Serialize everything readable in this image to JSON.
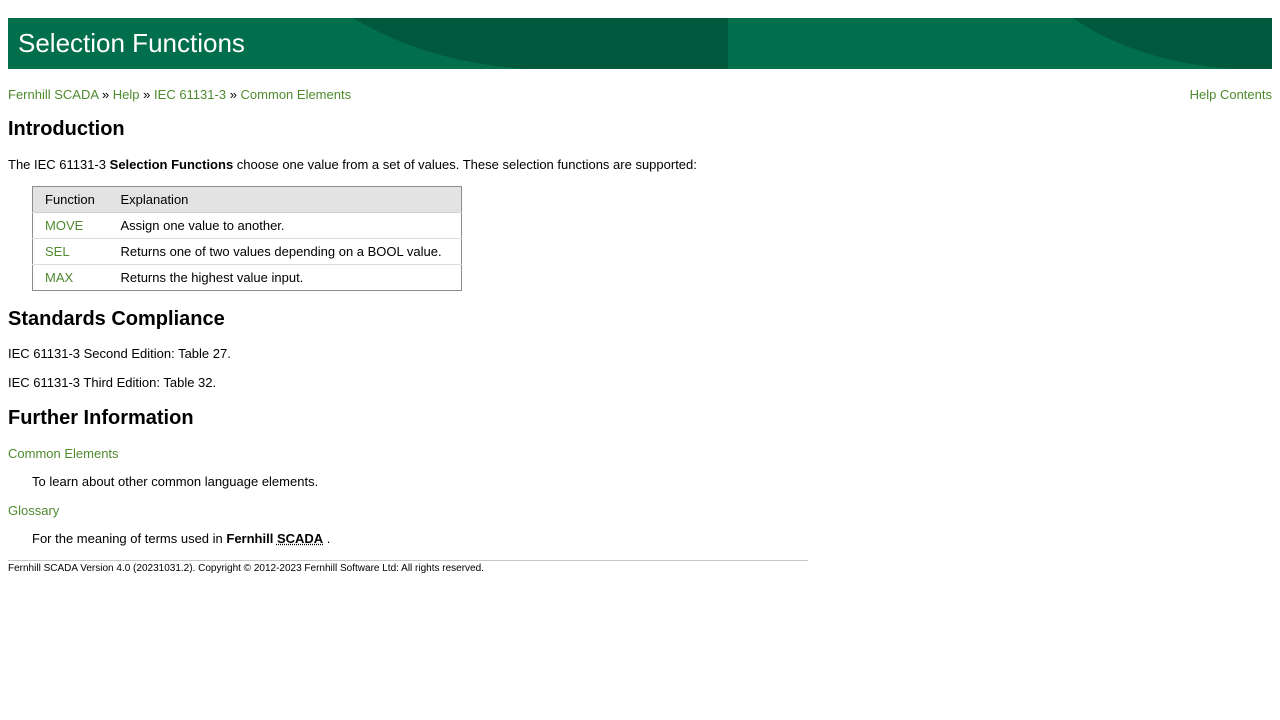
{
  "banner": {
    "title": "Selection Functions",
    "color": "#016e4c"
  },
  "breadcrumb": {
    "items": [
      "Fernhill SCADA",
      "Help",
      "IEC 61131-3",
      "Common Elements"
    ],
    "separator": "»"
  },
  "help_contents": "Help Contents",
  "introduction": {
    "heading": "Introduction",
    "text_before": "The IEC 61131-3 ",
    "text_bold": "Selection Functions",
    "text_after": " choose one value from a set of values. These selection functions are supported:"
  },
  "table": {
    "headers": [
      "Function",
      "Explanation"
    ],
    "rows": [
      {
        "function": "MOVE",
        "explanation": "Assign one value to another."
      },
      {
        "function": "SEL",
        "explanation": "Returns one of two values depending on a BOOL value."
      },
      {
        "function": "MAX",
        "explanation": "Returns the highest value input."
      }
    ]
  },
  "standards": {
    "heading": "Standards Compliance",
    "lines": [
      "IEC 61131-3 Second Edition: Table 27.",
      "IEC 61131-3 Third Edition: Table 32."
    ]
  },
  "further": {
    "heading": "Further Information",
    "items": [
      {
        "term": "Common Elements",
        "desc": "To learn about other common language elements."
      },
      {
        "term": "Glossary",
        "desc_prefix": "For the meaning of terms used in ",
        "desc_bold": "Fernhill",
        "desc_abbr": "SCADA",
        "desc_suffix": " ."
      }
    ]
  },
  "footer": "Fernhill SCADA Version 4.0 (20231031.2). Copyright © 2012-2023 Fernhill Software Ltd: All rights reserved.",
  "colors": {
    "link": "#4f8a2f",
    "banner": "#016e4c",
    "banner_swoosh": "#00583d"
  }
}
